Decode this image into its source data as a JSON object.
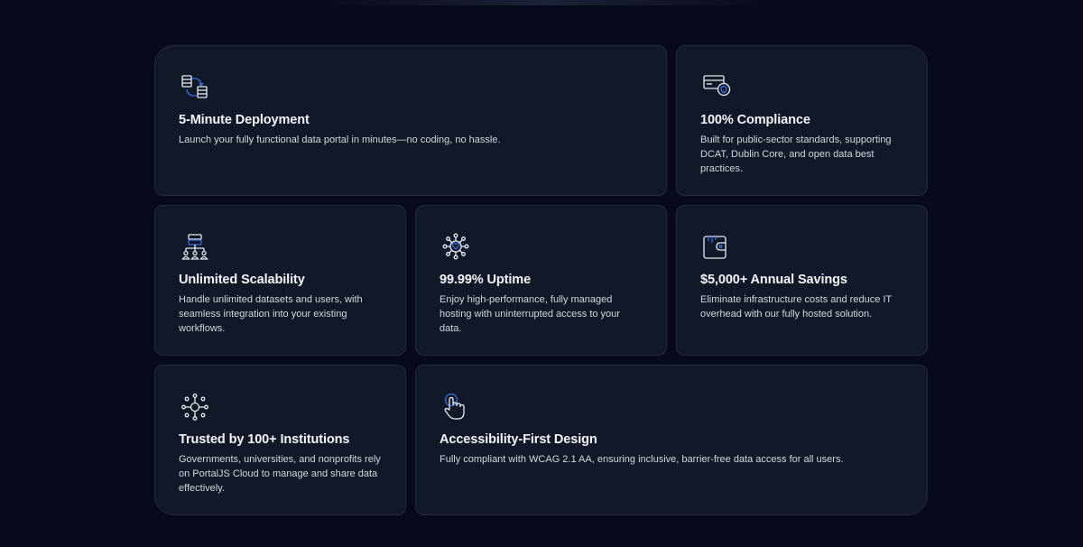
{
  "features": [
    {
      "id": "deployment",
      "icon": "database-sync-icon",
      "title": "5-Minute Deployment",
      "description": "Launch your fully functional data portal in minutes—no coding, no hassle."
    },
    {
      "id": "compliance",
      "icon": "card-shield-icon",
      "title": "100% Compliance",
      "description": "Built for public-sector standards, supporting DCAT, Dublin Core, and open data best practices."
    },
    {
      "id": "scalability",
      "icon": "server-users-icon",
      "title": "Unlimited Scalability",
      "description": "Handle unlimited datasets and users, with seamless integration into your existing workflows."
    },
    {
      "id": "uptime",
      "icon": "network-heart-icon",
      "title": "99.99% Uptime",
      "description": "Enjoy high-performance, fully managed hosting with uninterrupted access to your data."
    },
    {
      "id": "savings",
      "icon": "wallet-icon",
      "title": "$5,000+ Annual Savings",
      "description": "Eliminate infrastructure costs and reduce IT overhead with our fully hosted solution."
    },
    {
      "id": "trusted",
      "icon": "hub-network-icon",
      "title": "Trusted by 100+ Institutions",
      "description": "Governments, universities, and nonprofits rely on PortalJS Cloud to manage and share data effectively."
    },
    {
      "id": "accessibility",
      "icon": "pointer-hand-icon",
      "title": "Accessibility-First Design",
      "description": "Fully compliant with WCAG 2.1 AA, ensuring inclusive, barrier-free data access for all users."
    }
  ],
  "colors": {
    "background": "#060a1a",
    "card": "#111827",
    "cardBorder": "#232c3d",
    "iconStroke": "#e8ecf4",
    "iconAccent": "#3b6fe0"
  }
}
